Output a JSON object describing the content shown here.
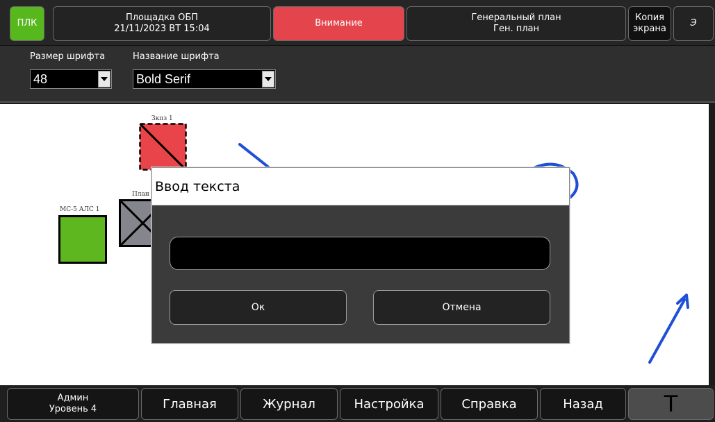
{
  "topbar": {
    "plc_label": "ПЛК",
    "site_name": "Площадка ОБП",
    "datetime": "21/11/2023 ВТ 15:04",
    "alert_label": "Внимание",
    "plan_title": "Генеральный план",
    "plan_subtitle": "Ген. план",
    "screenshot_line1": "Копия",
    "screenshot_line2": "экрана",
    "lang_label": "Э"
  },
  "fontbar": {
    "size_label": "Размер шрифта",
    "size_value": "48",
    "name_label": "Название шрифта",
    "name_value": "Bold Serif"
  },
  "canvas": {
    "objects": [
      {
        "label": "Зкпз 1",
        "color": "#e8444a"
      },
      {
        "label": "План",
        "color": "#85858d"
      },
      {
        "label": "МС-5 АЛС 1",
        "color": "#5fb71f"
      }
    ],
    "arrow_color": "#1f4fd6"
  },
  "dialog": {
    "title": "Ввод текста",
    "input_value": "",
    "ok_label": "Ок",
    "cancel_label": "Отмена"
  },
  "bottombar": {
    "user_name": "Админ",
    "user_level": "Уровень 4",
    "home_label": "Главная",
    "journal_label": "Журнал",
    "settings_label": "Настройка",
    "help_label": "Справка",
    "back_label": "Назад",
    "text_tool_label": "T"
  }
}
